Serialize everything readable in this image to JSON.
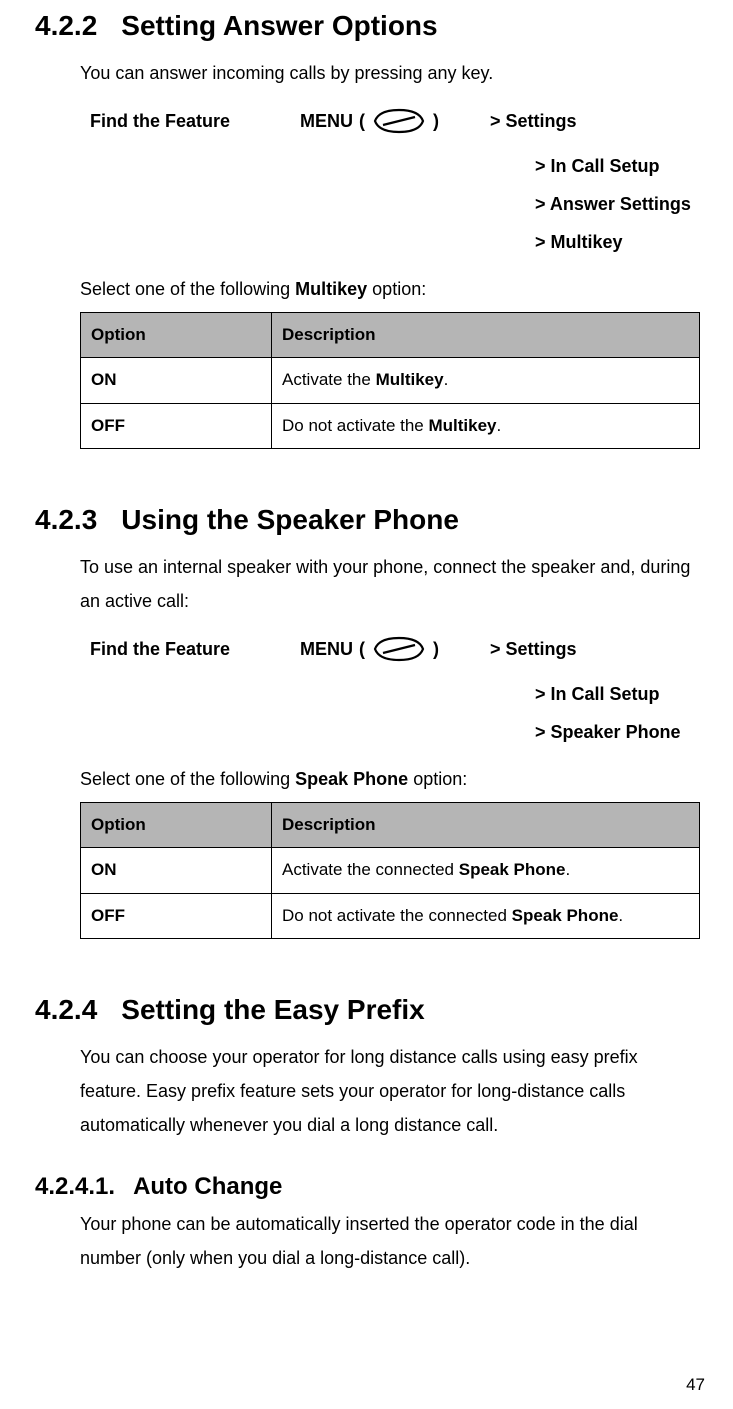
{
  "sections": [
    {
      "num": "4.2.2",
      "title": "Setting Answer Options",
      "intro": "You can answer incoming calls by pressing any key.",
      "find_label": "Find the Feature",
      "menu_word": "MENU",
      "path": [
        "> Settings",
        "> In Call Setup",
        "> Answer Settings",
        "> Multikey"
      ],
      "select_pre": "Select one of the following ",
      "select_bold": "Multikey",
      "select_post": " option:",
      "table": {
        "headers": [
          "Option",
          "Description"
        ],
        "rows": [
          {
            "opt": "ON",
            "pre": "Activate the ",
            "bold": "Multikey",
            "post": "."
          },
          {
            "opt": "OFF",
            "pre": "Do not activate the ",
            "bold": "Multikey",
            "post": "."
          }
        ]
      }
    },
    {
      "num": "4.2.3",
      "title": "Using the Speaker Phone",
      "intro": "To use an internal speaker with your phone, connect the speaker and, during an active call:",
      "find_label": "Find the Feature",
      "menu_word": "MENU",
      "path": [
        "> Settings",
        "> In Call Setup",
        "> Speaker Phone"
      ],
      "select_pre": "Select one of the following ",
      "select_bold": "Speak Phone",
      "select_post": " option:",
      "table": {
        "headers": [
          "Option",
          "Description"
        ],
        "rows": [
          {
            "opt": "ON",
            "pre": "Activate the connected ",
            "bold": "Speak Phone",
            "post": "."
          },
          {
            "opt": "OFF",
            "pre": "Do not activate the connected ",
            "bold": "Speak Phone",
            "post": "."
          }
        ]
      }
    },
    {
      "num": "4.2.4",
      "title": "Setting the Easy Prefix",
      "intro": "You can choose your operator for long distance calls using easy prefix feature. Easy prefix feature sets your operator for long-distance calls automatically whenever you dial a long distance call.",
      "sub": {
        "num": "4.2.4.1.",
        "title": "Auto Change",
        "intro": "Your phone can be automatically inserted the operator code in the dial number (only when you dial a long-distance call)."
      }
    }
  ],
  "page_number": "47"
}
